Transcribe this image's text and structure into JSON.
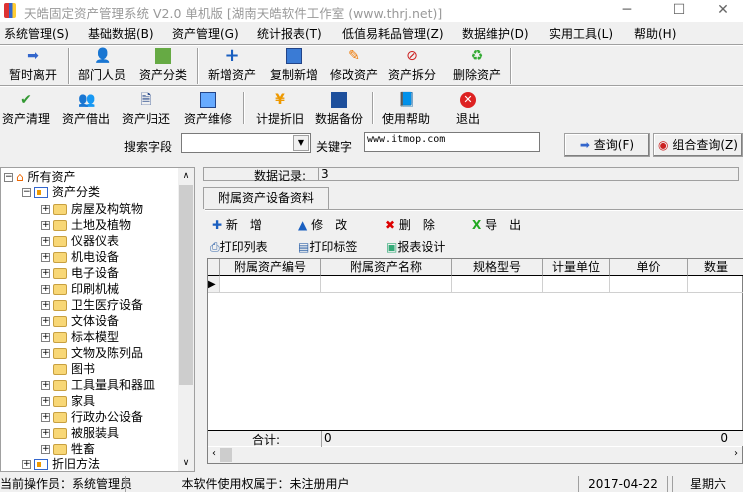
{
  "window": {
    "title": "天皓固定资产管理系统 V2.0 单机版   [湖南天皓软件工作室 (www.thrj.net)]",
    "minimize": "─",
    "maximize": "☐",
    "close": "✕"
  },
  "menu": [
    "系统管理(S)",
    "基础数据(B)",
    "资产管理(G)",
    "统计报表(T)",
    "低值易耗品管理(Z)",
    "数据维护(D)",
    "实用工具(L)",
    "帮助(H)"
  ],
  "toolbar1": [
    {
      "label": "暂时离开",
      "icon": "exit-arrow-icon"
    },
    {
      "label": "部门人员",
      "icon": "people-icon"
    },
    {
      "label": "资产分类",
      "icon": "category-icon"
    },
    {
      "label": "新增资产",
      "icon": "plus-icon"
    },
    {
      "label": "复制新增",
      "icon": "copy-icon"
    },
    {
      "label": "修改资产",
      "icon": "edit-icon"
    },
    {
      "label": "资产拆分",
      "icon": "split-icon"
    },
    {
      "label": "删除资产",
      "icon": "delete-icon"
    }
  ],
  "toolbar2": [
    {
      "label": "资产清理",
      "icon": "clean-icon"
    },
    {
      "label": "资产借出",
      "icon": "lend-icon"
    },
    {
      "label": "资产归还",
      "icon": "return-icon"
    },
    {
      "label": "资产维修",
      "icon": "repair-icon"
    },
    {
      "label": "计提折旧",
      "icon": "depreciation-icon"
    },
    {
      "label": "数据备份",
      "icon": "floppy-icon"
    },
    {
      "label": "使用帮助",
      "icon": "help-book-icon"
    },
    {
      "label": "退出",
      "icon": "quit-icon"
    }
  ],
  "search": {
    "field_label": "搜索字段",
    "field_value": "",
    "keyword_label": "关键字",
    "keyword_value": "www.itmop.com",
    "query_button": "查询(F)",
    "combo_query_button": "组合查询(Z)"
  },
  "tree": {
    "root": "所有资产",
    "category": "资产分类",
    "items": [
      "房屋及构筑物",
      "土地及植物",
      "仪器仪表",
      "机电设备",
      "电子设备",
      "印刷机械",
      "卫生医疗设备",
      "文体设备",
      "标本模型",
      "文物及陈列品",
      "图书",
      "工具量具和器皿",
      "家具",
      "行政办公设备",
      "被服装具",
      "牲畜"
    ],
    "depreciation": "折旧方法"
  },
  "records": {
    "label": "数据记录:",
    "value": "3"
  },
  "tab": "附属资产设备资料",
  "actions": {
    "add": "新　增",
    "edit": "修　改",
    "delete": "删　除",
    "export": "导　出",
    "print_list": "打印列表",
    "print_label": "打印标签",
    "report_design": "报表设计"
  },
  "grid": {
    "columns": [
      "附属资产编号",
      "附属资产名称",
      "规格型号",
      "计量单位",
      "单价",
      "数量"
    ],
    "footer_label": "合计:",
    "footer_values": [
      "0",
      "0"
    ]
  },
  "status": {
    "operator": "当前操作员：系统管理员",
    "license": "本软件使用权属于：未注册用户",
    "date": "2017-04-22",
    "weekday": "星期六"
  }
}
